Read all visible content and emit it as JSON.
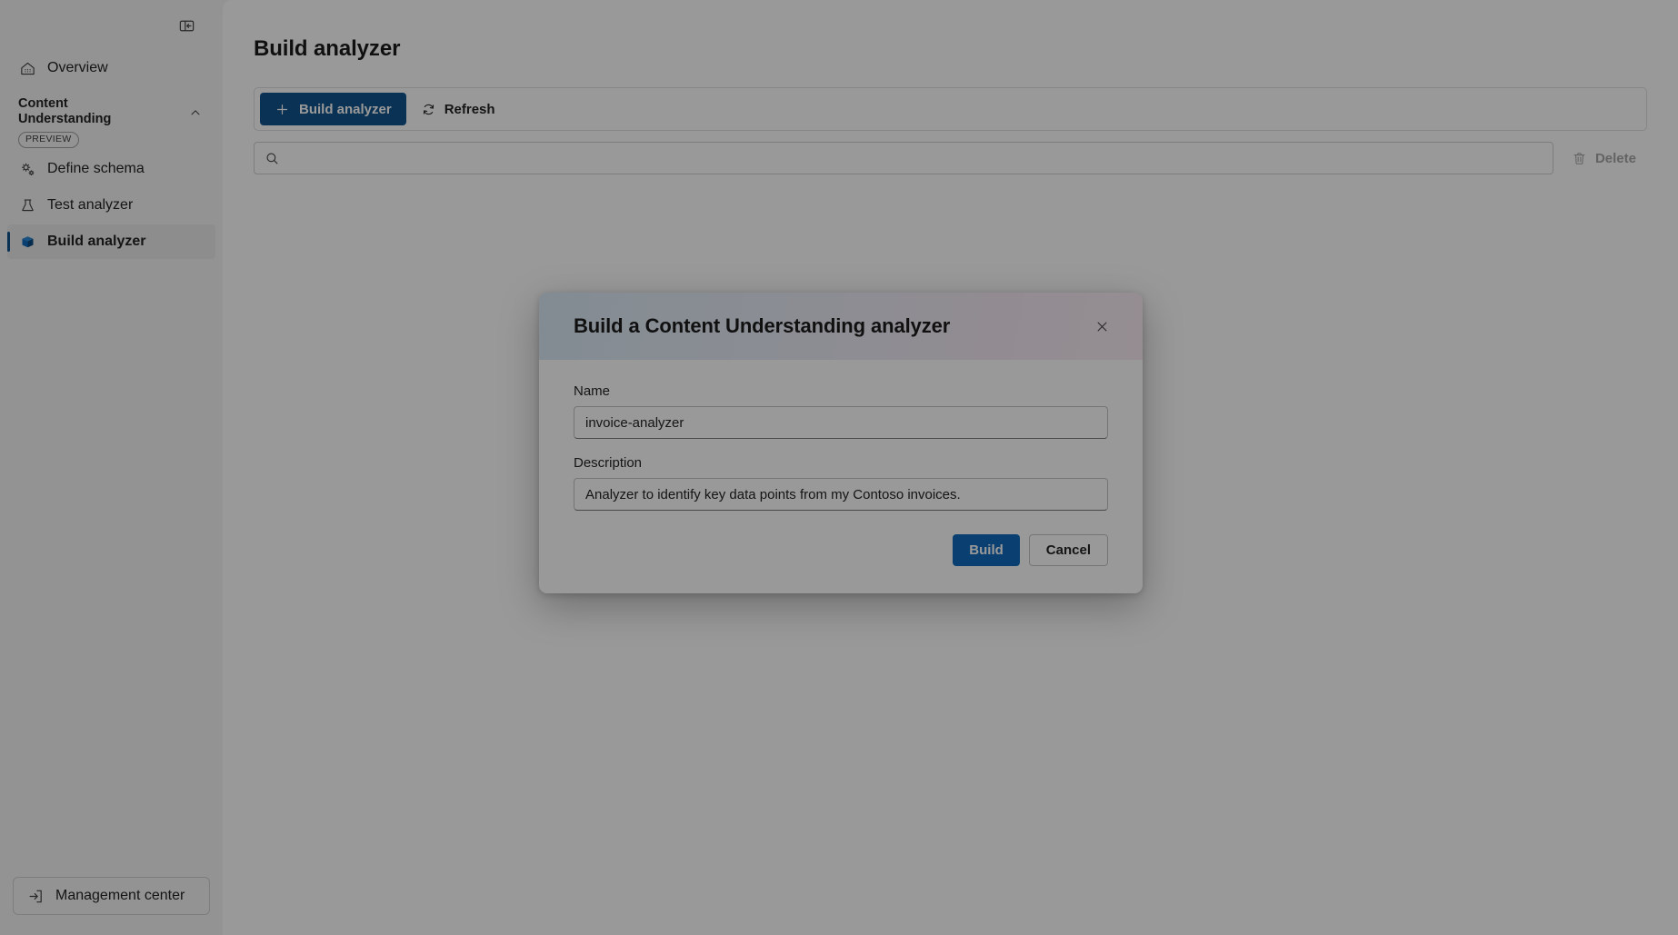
{
  "sidebar": {
    "toggle_icon": "panel-collapse-icon",
    "overview": {
      "label": "Overview",
      "icon": "home-icon"
    },
    "group": {
      "title": "Content Understanding",
      "badge": "PREVIEW",
      "chevron_icon": "chevron-up-icon"
    },
    "items": [
      {
        "label": "Define schema",
        "icon": "gears-icon",
        "selected": false
      },
      {
        "label": "Test analyzer",
        "icon": "beaker-icon",
        "selected": false
      },
      {
        "label": "Build analyzer",
        "icon": "box-3d-icon",
        "selected": true
      }
    ],
    "management_center": {
      "label": "Management center",
      "icon": "arrow-enter-icon"
    },
    "selected_accent": "#0f548c"
  },
  "main": {
    "page_title": "Build analyzer",
    "toolbar": {
      "build_analyzer_label": "Build analyzer",
      "build_analyzer_icon": "plus-icon",
      "refresh_label": "Refresh",
      "refresh_icon": "refresh-icon",
      "primary_color": "#0f548c"
    },
    "search": {
      "value": "",
      "placeholder": "",
      "icon": "search-icon"
    },
    "delete": {
      "label": "Delete",
      "icon": "trash-icon",
      "disabled": true
    }
  },
  "dialog": {
    "title": "Build a Content Understanding analyzer",
    "close_icon": "close-icon",
    "header_gradient_from": "#dbeaf6",
    "header_gradient_to": "#f8ecf2",
    "fields": [
      {
        "label": "Name",
        "value": "invoice-analyzer",
        "placeholder": ""
      },
      {
        "label": "Description",
        "value": "Analyzer to identify key data points from my Contoso invoices.",
        "placeholder": ""
      }
    ],
    "build_label": "Build",
    "cancel_label": "Cancel",
    "build_color": "#0f6cbd"
  }
}
